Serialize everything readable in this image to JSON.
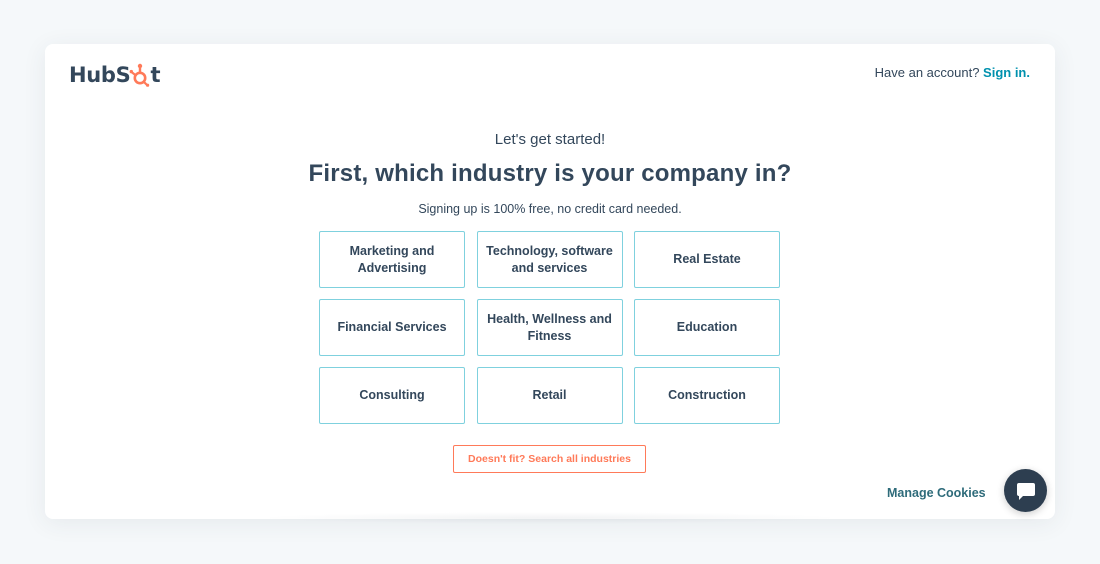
{
  "brand": {
    "logo_prefix": "HubS",
    "logo_suffix": "t",
    "accent_color": "#ff7a59",
    "link_color": "#0091ae",
    "text_color": "#33475b"
  },
  "header": {
    "account_prompt": "Have an account?",
    "signin_label": "Sign in."
  },
  "main": {
    "eyebrow": "Let's get started!",
    "title": "First, which industry is your company in?",
    "subtitle": "Signing up is 100% free, no credit card needed.",
    "industries": [
      "Marketing and Advertising",
      "Technology, software and services",
      "Real Estate",
      "Financial Services",
      "Health, Wellness and Fitness",
      "Education",
      "Consulting",
      "Retail",
      "Construction"
    ],
    "search_button_label": "Doesn't fit? Search all industries"
  },
  "footer": {
    "manage_cookies_label": "Manage Cookies",
    "chat_icon": "chat-bubble-icon"
  }
}
